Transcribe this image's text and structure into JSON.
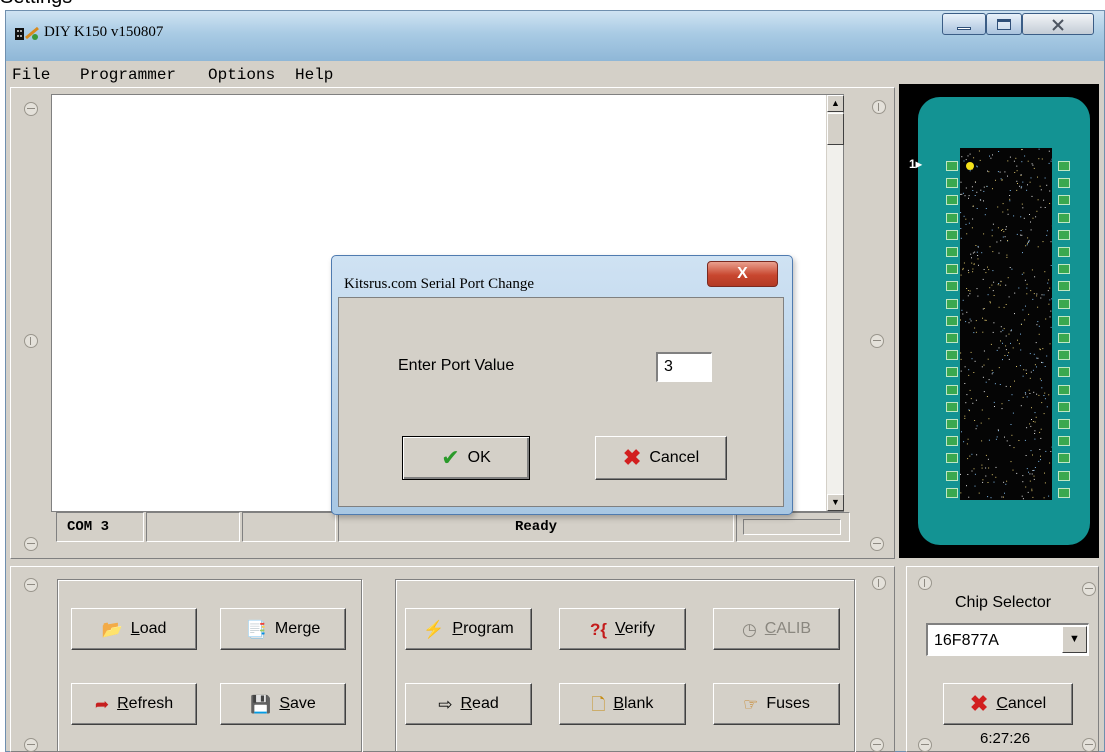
{
  "clipped_heading": "Settings",
  "window": {
    "title": "DIY K150 v150807",
    "caption_buttons": {
      "minimize_icon": "minimize-icon",
      "maximize_icon": "maximize-icon",
      "close_icon": "close-icon"
    }
  },
  "menu": [
    "File",
    "Programmer",
    "Options",
    "Help"
  ],
  "status_bar": {
    "port": "COM 3",
    "state": "Ready"
  },
  "chip_view": {
    "pin1_label": "1",
    "pins_per_side": 20
  },
  "dialog": {
    "title": "Kitsrus.com Serial Port Change",
    "close_glyph": "X",
    "label": "Enter Port Value",
    "port_value": "3",
    "ok_label": "OK",
    "cancel_label": "Cancel"
  },
  "file_buttons": {
    "load": "Load",
    "merge": "Merge",
    "refresh": "Refresh",
    "save": "Save"
  },
  "prog_buttons": {
    "program": "Program",
    "verify": "Verify",
    "calib": "CALIB",
    "read": "Read",
    "blank": "Blank",
    "fuses": "Fuses"
  },
  "chip_selector": {
    "label": "Chip Selector",
    "value": "16F877A",
    "cancel_label": "Cancel",
    "clock": "6:27:26"
  },
  "colors": {
    "board": "#139393",
    "chip_area": "#000000",
    "face": "#d4d0c8",
    "dialog_close": "#c8472f"
  }
}
